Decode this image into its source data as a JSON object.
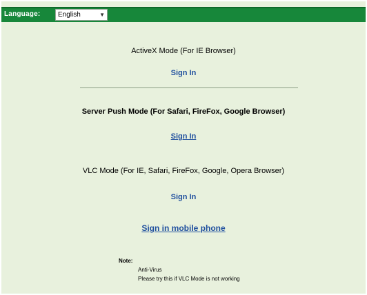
{
  "header": {
    "language_label": "Language:",
    "language_value": "English"
  },
  "modes": [
    {
      "title": "ActiveX Mode (For IE Browser)",
      "link": "Sign In"
    },
    {
      "title": "Server Push Mode (For Safari, FireFox, Google Browser)",
      "link": "Sign In"
    },
    {
      "title": "VLC Mode (For IE, Safari, FireFox, Google, Opera Browser)",
      "link": "Sign In"
    }
  ],
  "mobile_link": "Sign in mobile phone",
  "notes": {
    "title": "Note:",
    "line1": "Anti-Virus",
    "line2": "Please try this if VLC Mode is not working"
  }
}
